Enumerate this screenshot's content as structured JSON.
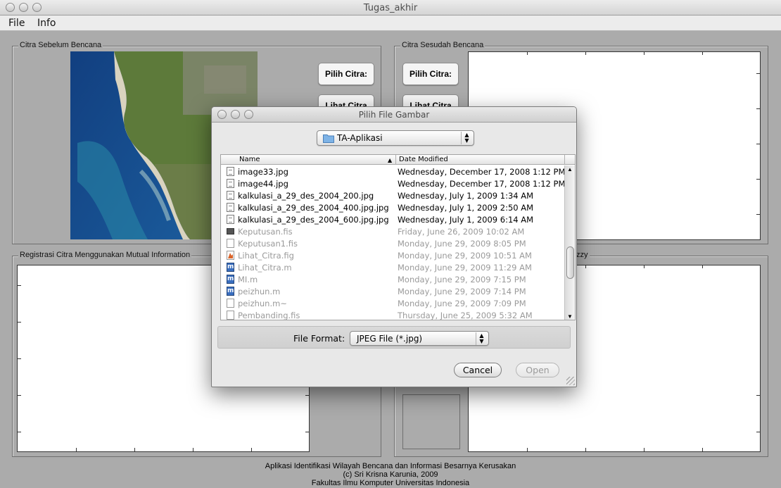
{
  "window": {
    "title": "Tugas_akhir"
  },
  "menu": [
    "File",
    "Info"
  ],
  "panels": {
    "before": "Citra Sebelum Bencana",
    "after": "Citra Sesudah Bencana",
    "registration": "Registrasi Citra Menggunakan Mutual Information",
    "fuzzy_fragment": "zzy"
  },
  "buttons": {
    "pilih_citra": "Pilih Citra:",
    "lihat_citra": "Lihat Citra"
  },
  "footer": {
    "line1": "Aplikasi Identifikasi Wilayah Bencana dan Informasi Besarnya Kerusakan",
    "line2": "(c) Sri Krisna Karunia, 2009",
    "line3": "Fakultas Ilmu Komputer Universitas Indonesia"
  },
  "dialog": {
    "title": "Pilih File Gambar",
    "location": "TA-Aplikasi",
    "columns": {
      "name": "Name",
      "date": "Date Modified"
    },
    "files": [
      {
        "name": "image33.jpg",
        "date": "Wednesday, December 17, 2008 1:12 PM",
        "icon": "jpg-file-icon",
        "enabled": true
      },
      {
        "name": "image44.jpg",
        "date": "Wednesday, December 17, 2008 1:12 PM",
        "icon": "jpg-file-icon",
        "enabled": true
      },
      {
        "name": "kalkulasi_a_29_des_2004_200.jpg",
        "date": "Wednesday, July 1, 2009 1:34 AM",
        "icon": "jpg-file-icon",
        "enabled": true
      },
      {
        "name": "kalkulasi_a_29_des_2004_400.jpg.jpg",
        "date": "Wednesday, July 1, 2009 2:50 AM",
        "icon": "jpg-file-icon",
        "enabled": true
      },
      {
        "name": "kalkulasi_a_29_des_2004_600.jpg.jpg",
        "date": "Wednesday, July 1, 2009 6:14 AM",
        "icon": "jpg-file-icon",
        "enabled": true
      },
      {
        "name": "Keputusan.fis",
        "date": "Friday, June 26, 2009 10:02 AM",
        "icon": "fis-file-icon",
        "enabled": false
      },
      {
        "name": "Keputusan1.fis",
        "date": "Monday, June 29, 2009 8:05 PM",
        "icon": "blank-file-icon",
        "enabled": false
      },
      {
        "name": "Lihat_Citra.fig",
        "date": "Monday, June 29, 2009 10:51 AM",
        "icon": "matlab-fig-icon",
        "enabled": false
      },
      {
        "name": "Lihat_Citra.m",
        "date": "Monday, June 29, 2009 11:29 AM",
        "icon": "matlab-m-icon",
        "enabled": false
      },
      {
        "name": "MI.m",
        "date": "Monday, June 29, 2009 7:15 PM",
        "icon": "matlab-m-icon",
        "enabled": false
      },
      {
        "name": "peizhun.m",
        "date": "Monday, June 29, 2009 7:14 PM",
        "icon": "matlab-m-icon",
        "enabled": false
      },
      {
        "name": "peizhun.m~",
        "date": "Monday, June 29, 2009 7:09 PM",
        "icon": "blank-file-icon",
        "enabled": false
      },
      {
        "name": "Pembanding.fis",
        "date": "Thursday, June 25, 2009 5:32 AM",
        "icon": "blank-file-icon",
        "enabled": false
      }
    ],
    "file_format_label": "File Format:",
    "file_format_value": "JPEG File (*.jpg)",
    "cancel": "Cancel",
    "open": "Open"
  }
}
